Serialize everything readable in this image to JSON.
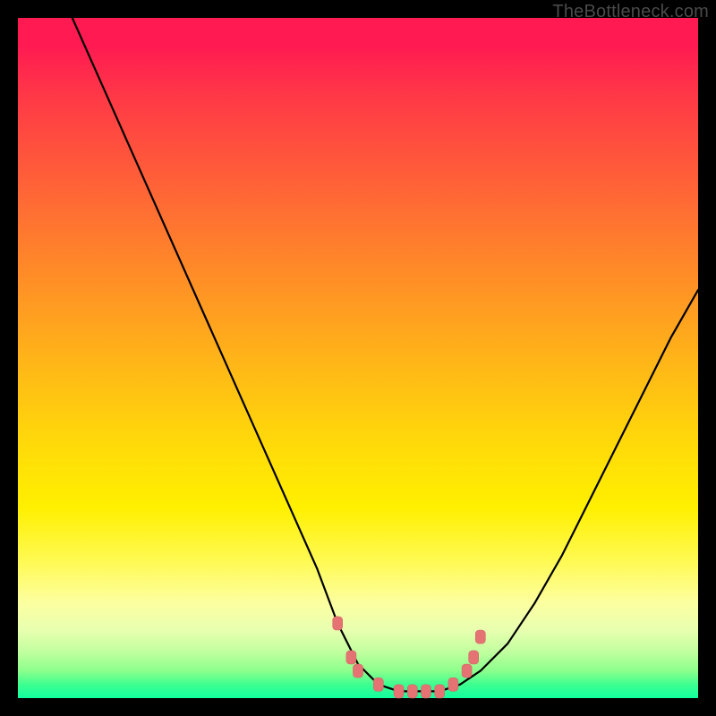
{
  "watermark": "TheBottleneck.com",
  "colors": {
    "frame": "#000000",
    "curve": "#000000",
    "marker": "#e57373",
    "marker_stroke": "#d46666"
  },
  "chart_data": {
    "type": "line",
    "title": "",
    "xlabel": "",
    "ylabel": "",
    "xlim": [
      0,
      100
    ],
    "ylim": [
      0,
      100
    ],
    "grid": false,
    "legend": false,
    "series": [
      {
        "name": "bottleneck-curve",
        "x": [
          8,
          12,
          16,
          20,
          24,
          28,
          32,
          36,
          40,
          44,
          47,
          50,
          53,
          56,
          59,
          62,
          65,
          68,
          72,
          76,
          80,
          84,
          88,
          92,
          96,
          100
        ],
        "values": [
          100,
          91,
          82,
          73,
          64,
          55,
          46,
          37,
          28,
          19,
          11,
          5,
          2,
          1,
          1,
          1,
          2,
          4,
          8,
          14,
          21,
          29,
          37,
          45,
          53,
          60
        ]
      }
    ],
    "markers": {
      "name": "highlight-points",
      "points": [
        {
          "x": 47,
          "y": 11
        },
        {
          "x": 49,
          "y": 6
        },
        {
          "x": 50,
          "y": 4
        },
        {
          "x": 53,
          "y": 2
        },
        {
          "x": 56,
          "y": 1
        },
        {
          "x": 58,
          "y": 1
        },
        {
          "x": 60,
          "y": 1
        },
        {
          "x": 62,
          "y": 1
        },
        {
          "x": 64,
          "y": 2
        },
        {
          "x": 66,
          "y": 4
        },
        {
          "x": 67,
          "y": 6
        },
        {
          "x": 68,
          "y": 9
        }
      ]
    }
  }
}
